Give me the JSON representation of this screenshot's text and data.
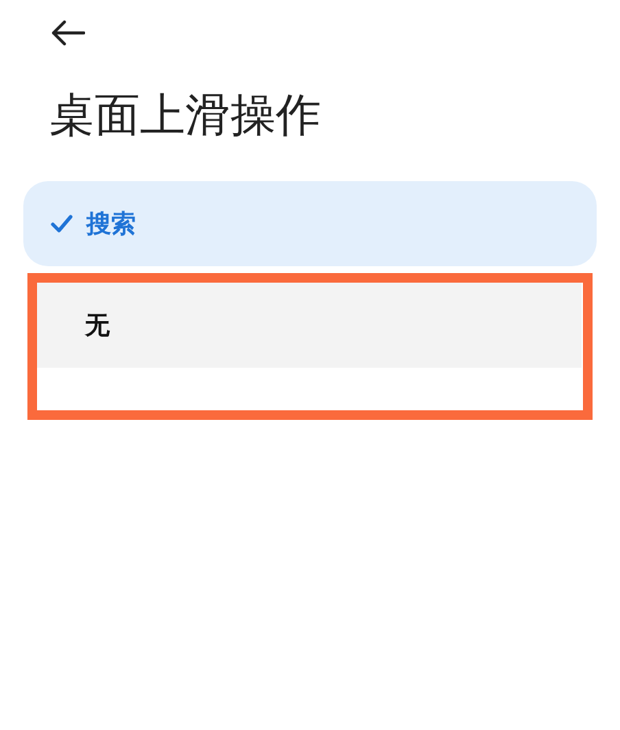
{
  "title": "桌面上滑操作",
  "options": [
    {
      "label": "搜索",
      "selected": true,
      "highlighted": false
    },
    {
      "label": "无",
      "selected": false,
      "highlighted": true
    }
  ]
}
